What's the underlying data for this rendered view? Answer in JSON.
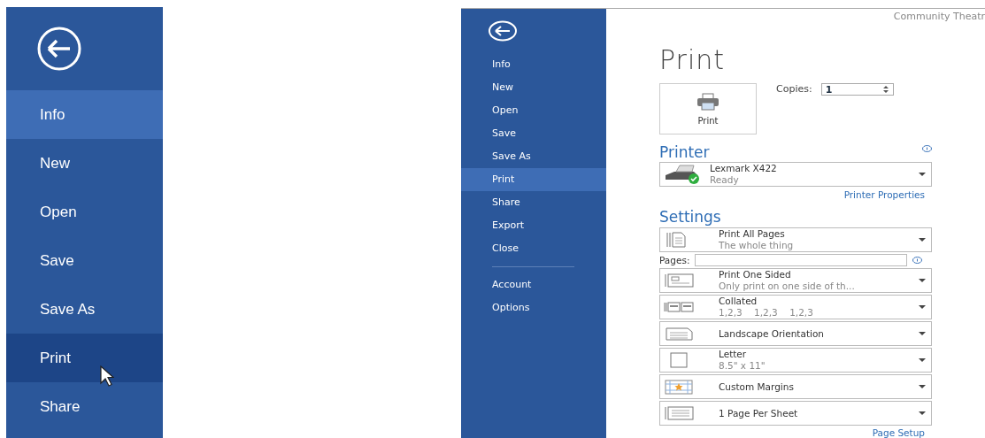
{
  "left_menu": {
    "items": [
      {
        "label": "Info",
        "selected": true,
        "hovered": false
      },
      {
        "label": "New",
        "selected": false,
        "hovered": false
      },
      {
        "label": "Open",
        "selected": false,
        "hovered": false
      },
      {
        "label": "Save",
        "selected": false,
        "hovered": false
      },
      {
        "label": "Save As",
        "selected": false,
        "hovered": false
      },
      {
        "label": "Print",
        "selected": false,
        "hovered": true
      },
      {
        "label": "Share",
        "selected": false,
        "hovered": false
      }
    ]
  },
  "backstage": {
    "document_title": "Community Theatr",
    "sidebar": {
      "groups": [
        [
          {
            "label": "Info",
            "selected": false
          },
          {
            "label": "New",
            "selected": false
          },
          {
            "label": "Open",
            "selected": false
          },
          {
            "label": "Save",
            "selected": false
          },
          {
            "label": "Save As",
            "selected": false
          },
          {
            "label": "Print",
            "selected": true
          },
          {
            "label": "Share",
            "selected": false
          },
          {
            "label": "Export",
            "selected": false
          },
          {
            "label": "Close",
            "selected": false
          }
        ],
        [
          {
            "label": "Account",
            "selected": false
          },
          {
            "label": "Options",
            "selected": false
          }
        ]
      ]
    },
    "title": "Print",
    "print_button": "Print",
    "copies": {
      "label": "Copies:",
      "value": "1"
    },
    "printer": {
      "heading": "Printer",
      "name": "Lexmark X422",
      "status": "Ready",
      "ready": true,
      "properties_link": "Printer Properties"
    },
    "settings": {
      "heading": "Settings",
      "items": [
        {
          "kind": "dropdown",
          "title": "Print All Pages",
          "subtitle": "The whole thing"
        },
        {
          "kind": "pages",
          "label": "Pages:"
        },
        {
          "kind": "dropdown",
          "title": "Print One Sided",
          "subtitle": "Only print on one side of th..."
        },
        {
          "kind": "dropdown",
          "title": "Collated",
          "subtitle": "1,2,3    1,2,3    1,2,3"
        },
        {
          "kind": "dropdown",
          "title": "Landscape Orientation"
        },
        {
          "kind": "dropdown",
          "title": "Letter",
          "subtitle": "8.5\" x 11\""
        },
        {
          "kind": "dropdown",
          "title": "Custom Margins"
        },
        {
          "kind": "dropdown",
          "title": "1 Page Per Sheet"
        }
      ],
      "page_setup_link": "Page Setup"
    }
  }
}
